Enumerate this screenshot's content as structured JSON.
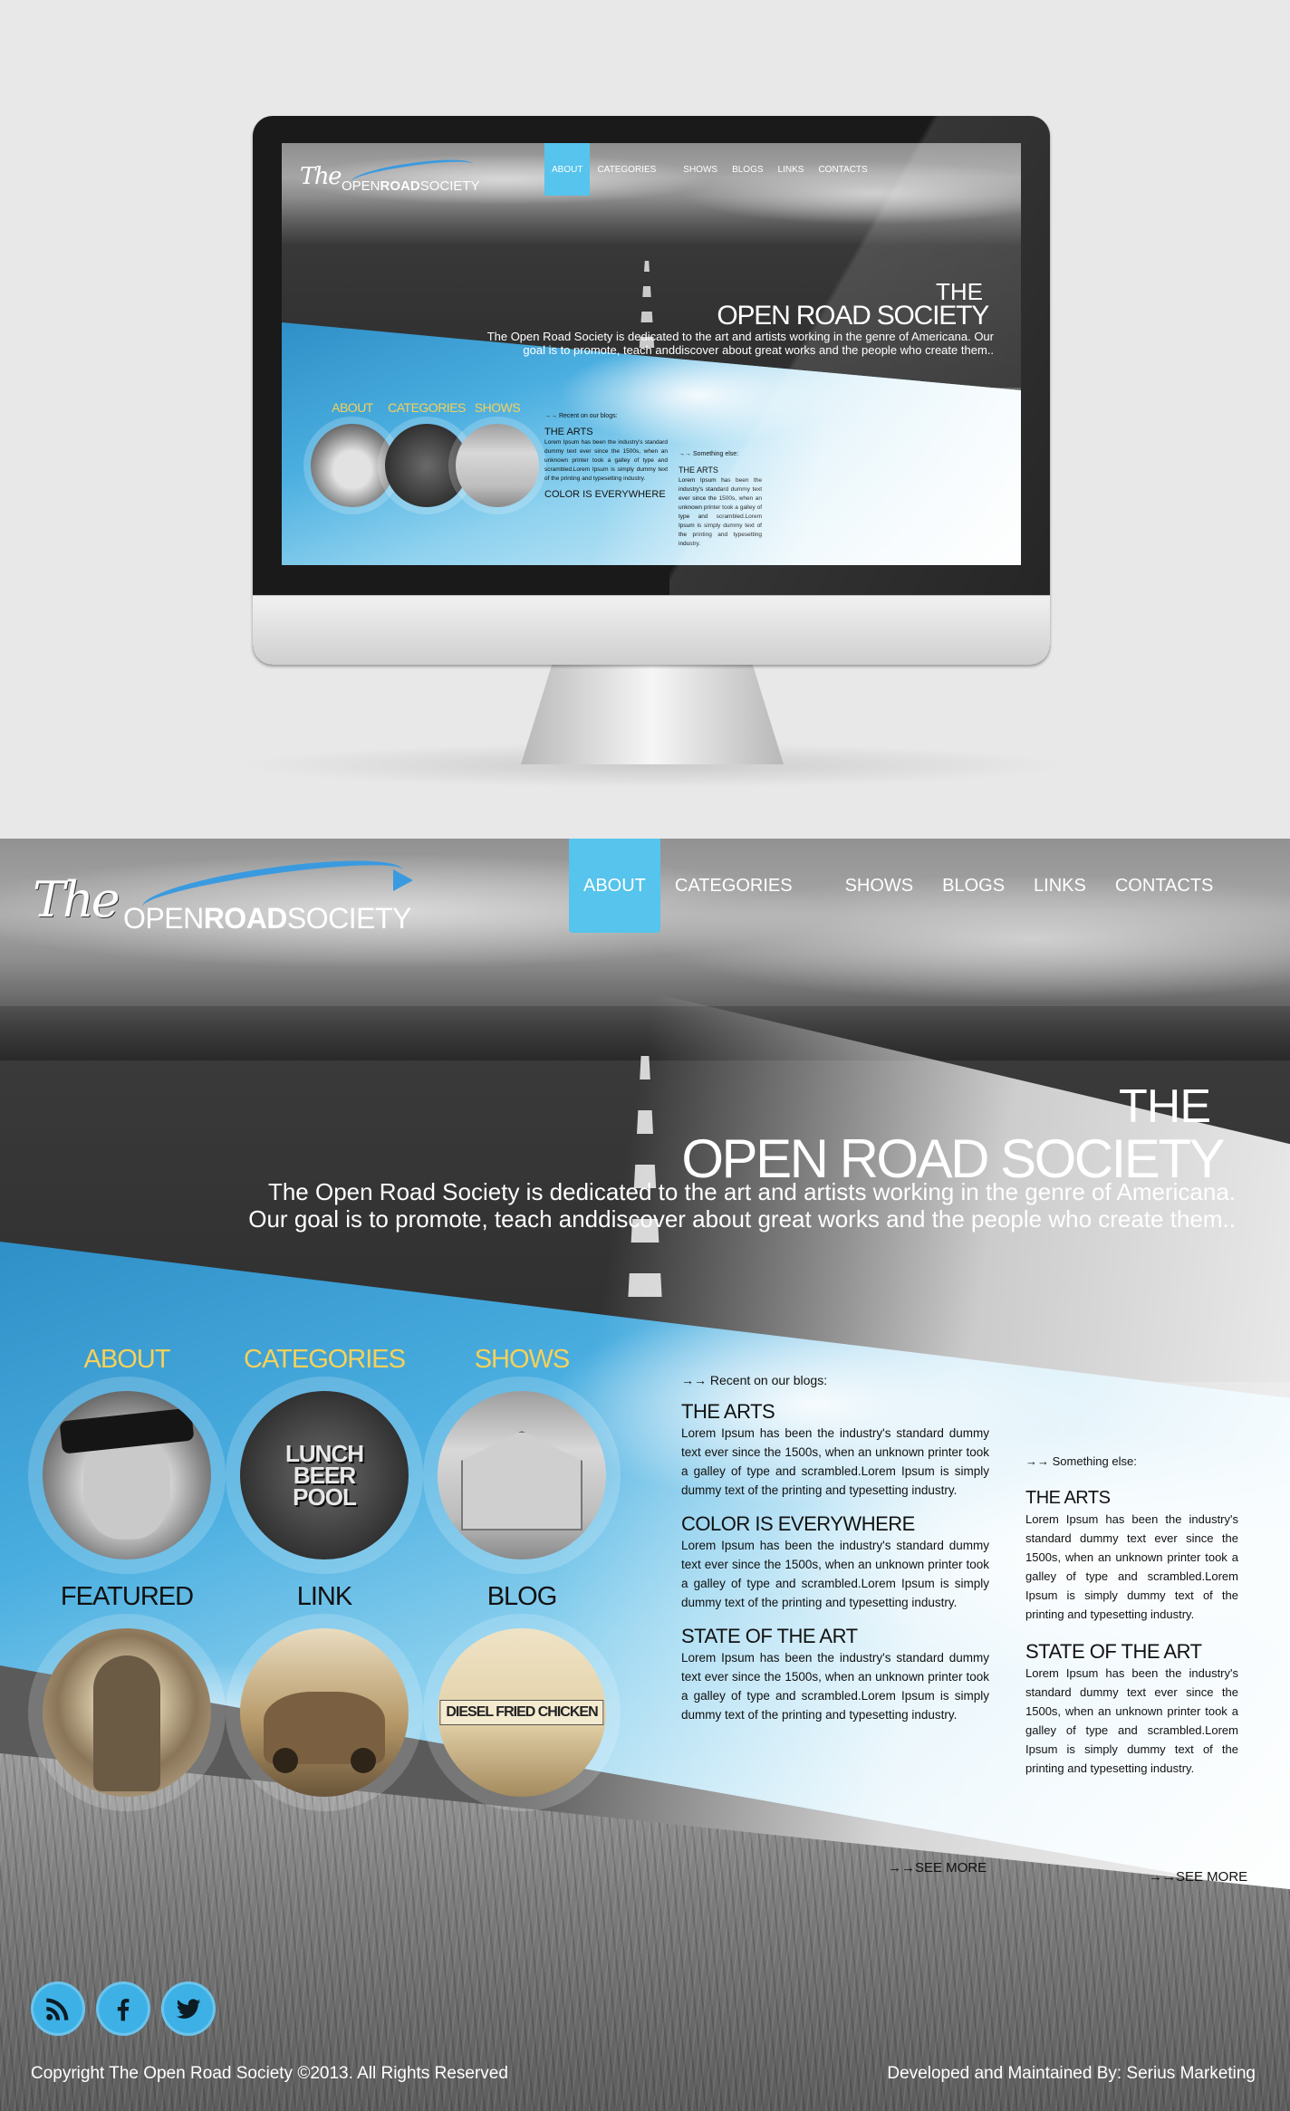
{
  "brand": {
    "logo_the": "The",
    "logo_open": "OPEN",
    "logo_road": "ROAD",
    "logo_society": "SOCIETY",
    "accent_color": "#56c4ec",
    "label_yellow": "#f5d15a"
  },
  "nav": {
    "items": [
      {
        "label": "ABOUT",
        "active": true
      },
      {
        "label": "CATEGORIES",
        "active": false
      },
      {
        "label": "SHOWS",
        "active": false
      },
      {
        "label": "BLOGS",
        "active": false
      },
      {
        "label": "LINKS",
        "active": false
      },
      {
        "label": "CONTACTS",
        "active": false
      }
    ]
  },
  "hero": {
    "title_small": "THE",
    "title_big": "OPEN ROAD SOCIETY",
    "description": "The Open Road Society is dedicated to the art and artists working in the genre of Americana. Our goal is to promote, teach anddiscover about great works and the people who create them.."
  },
  "sections": [
    {
      "label": "ABOUT",
      "icon": "man-bandana-photo"
    },
    {
      "label": "CATEGORIES",
      "icon": "lunch-beer-pool-sign-photo",
      "sign": "LUNCH BEER POOL"
    },
    {
      "label": "SHOWS",
      "icon": "old-barn-photo"
    },
    {
      "label": "FEATURED",
      "icon": "bearded-man-photo"
    },
    {
      "label": "LINK",
      "icon": "vintage-car-photo"
    },
    {
      "label": "BLOG",
      "icon": "diesel-fried-chicken-sign-photo",
      "sign": "DIESEL FRIED CHICKEN"
    }
  ],
  "blogs": {
    "kicker": "→→ Recent on our blogs:",
    "posts": [
      {
        "title": "THE ARTS",
        "body": "Lorem Ipsum has been the industry's standard dummy text ever since the 1500s, when an unknown printer took a galley of type and scrambled.Lorem Ipsum is simply dummy text of the printing and typesetting industry."
      },
      {
        "title": "COLOR IS EVERYWHERE",
        "body": "Lorem Ipsum has been the industry's standard dummy text ever since the 1500s, when an unknown printer took a galley of type and scrambled.Lorem Ipsum is simply dummy text of the printing and typesetting industry."
      },
      {
        "title": "STATE OF THE ART",
        "body": "Lorem Ipsum has been the industry's standard dummy text ever since the 1500s, when an unknown printer took a galley of type and scrambled.Lorem Ipsum is simply dummy text of the printing and typesetting industry."
      }
    ],
    "see_more": "→→SEE MORE"
  },
  "something_else": {
    "kicker": "→→ Something else:",
    "posts": [
      {
        "title": "THE ARTS",
        "body": "Lorem Ipsum has been the industry's standard dummy text ever since the 1500s, when an unknown printer took a galley of type and scrambled.Lorem Ipsum is simply dummy text of the printing and typesetting industry."
      },
      {
        "title": "STATE OF THE ART",
        "body": "Lorem Ipsum has been the industry's standard dummy text ever since the 1500s, when an unknown printer took a galley of type and scrambled.Lorem Ipsum is simply dummy text of the printing and typesetting industry."
      }
    ],
    "see_more": "→→SEE MORE"
  },
  "social": [
    {
      "icon": "rss-icon"
    },
    {
      "icon": "facebook-icon"
    },
    {
      "icon": "twitter-icon"
    }
  ],
  "footer": {
    "copyright": "Copyright The Open Road Society ©2013. All Rights Reserved",
    "credit": "Developed and Maintained By: Serius Marketing"
  },
  "mini": {
    "blog_cut_title": "COLOR IS EVERYWHERE"
  }
}
